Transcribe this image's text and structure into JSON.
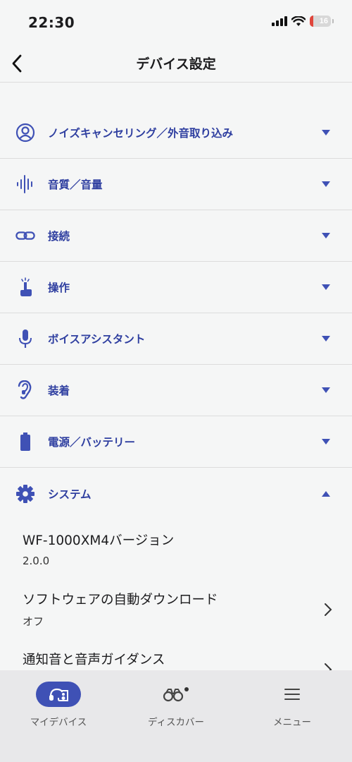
{
  "status_bar": {
    "time": "22:30",
    "battery_level": "16"
  },
  "header": {
    "title": "デバイス設定"
  },
  "sections": [
    {
      "label": "ノイズキャンセリング／外音取り込み",
      "icon": "noise-cancel-icon",
      "expanded": false
    },
    {
      "label": "音質／音量",
      "icon": "sound-wave-icon",
      "expanded": false
    },
    {
      "label": "接続",
      "icon": "link-icon",
      "expanded": false
    },
    {
      "label": "操作",
      "icon": "touch-icon",
      "expanded": false
    },
    {
      "label": "ボイスアシスタント",
      "icon": "microphone-icon",
      "expanded": false
    },
    {
      "label": "装着",
      "icon": "ear-icon",
      "expanded": false
    },
    {
      "label": "電源／バッテリー",
      "icon": "battery-icon",
      "expanded": false
    },
    {
      "label": "システム",
      "icon": "gear-icon",
      "expanded": true
    }
  ],
  "system": {
    "version_title": "WF-1000XM4バージョン",
    "version_value": "2.0.0",
    "auto_download_title": "ソフトウェアの自動ダウンロード",
    "auto_download_value": "オフ",
    "notification_title": "通知音と音声ガイダンス"
  },
  "tabs": [
    {
      "label": "マイデバイス",
      "icon": "headphones-icon",
      "active": true
    },
    {
      "label": "ディスカバー",
      "icon": "binoculars-icon",
      "active": false
    },
    {
      "label": "メニュー",
      "icon": "menu-icon",
      "active": false
    }
  ],
  "colors": {
    "accent": "#3f51b5",
    "label": "#2f3fa0",
    "background": "#f5f6f6",
    "tabbar": "#e8e8ea"
  }
}
